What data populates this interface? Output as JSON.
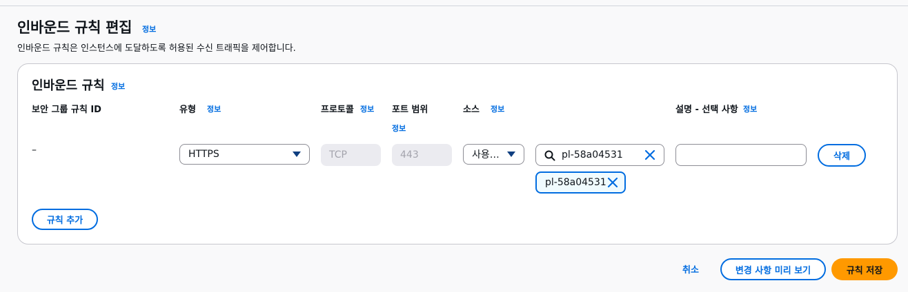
{
  "page": {
    "title": "인바운드 규칙 편집",
    "info": "정보",
    "description": "인바운드 규칙은 인스턴스에 도달하도록 허용된 수신 트래픽을 제어합니다."
  },
  "panel": {
    "title": "인바운드 규칙",
    "info": "정보"
  },
  "columns": {
    "rule_id": "보안 그룹 규칙 ID",
    "type": "유형",
    "type_info": "정보",
    "protocol": "프로토콜",
    "protocol_info": "정보",
    "port_range": "포트 범위",
    "port_range_info": "정보",
    "source": "소스",
    "source_info": "정보",
    "description": "설명 - 선택 사항",
    "description_info": "정보"
  },
  "rule": {
    "id": "–",
    "type": "HTTPS",
    "protocol": "TCP",
    "port_range": "443",
    "source_type": "사용…",
    "source_search_value": "pl-58a04531",
    "source_token": "pl-58a04531",
    "description_value": "",
    "delete_label": "삭제"
  },
  "actions": {
    "add_rule": "규칙 추가",
    "cancel": "취소",
    "preview": "변경 사항 미리 보기",
    "save": "규칙 저장"
  },
  "colors": {
    "accent": "#006ce0",
    "primary_button": "#ff9900",
    "disabled_field": "#ebebf0"
  },
  "icons": [
    "search-icon",
    "close-icon",
    "caret-down-icon"
  ]
}
